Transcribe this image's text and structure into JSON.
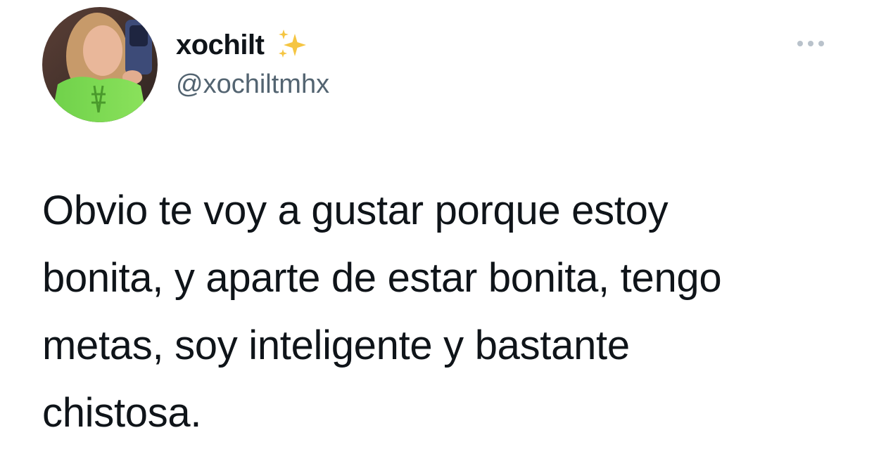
{
  "author": {
    "display_name": "xochilt",
    "name_emoji": "sparkles-icon",
    "handle": "@xochiltmhx",
    "avatar": "profile-photo"
  },
  "menu": {
    "icon": "more-horizontal-icon"
  },
  "tweet": {
    "lines": [
      "Obvio te voy a gustar porque estoy",
      "bonita, y aparte de estar bonita, tengo",
      "metas, soy inteligente y bastante",
      "chistosa."
    ]
  },
  "colors": {
    "text_primary": "#0f1419",
    "text_secondary": "#536471",
    "sparkle_gold": "#f5c542",
    "background": "#ffffff"
  }
}
